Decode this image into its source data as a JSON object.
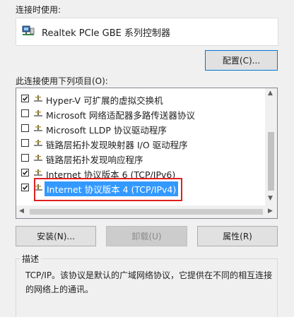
{
  "connect_using_label": "连接时使用:",
  "adapter": {
    "name": "Realtek PCIe GBE 系列控制器",
    "icon": "network-adapter-icon"
  },
  "configure_button": "配置(C)...",
  "items_label": "此连接使用下列项目(O):",
  "items": [
    {
      "label": "Hyper-V 可扩展的虚拟交换机",
      "checked": true,
      "selected": false
    },
    {
      "label": "Microsoft 网络适配器多路传送器协议",
      "checked": false,
      "selected": false
    },
    {
      "label": "Microsoft LLDP 协议驱动程序",
      "checked": false,
      "selected": false
    },
    {
      "label": "链路层拓扑发现映射器 I/O 驱动程序",
      "checked": false,
      "selected": false
    },
    {
      "label": "链路层拓扑发现响应程序",
      "checked": false,
      "selected": false
    },
    {
      "label": "Internet 协议版本 6 (TCP/IPv6)",
      "checked": true,
      "selected": false
    },
    {
      "label": "Internet 协议版本 4 (TCP/IPv4)",
      "checked": true,
      "selected": true
    }
  ],
  "install_button": "安装(N)...",
  "uninstall_button": "卸载(U)",
  "properties_button": "属性(R)",
  "description_title": "描述",
  "description_text": "TCP/IP。该协议是默认的广域网络协议，它提供在不同的相互连接的网络上的通讯。",
  "colors": {
    "selection": "#3399ff",
    "highlight_frame": "#e02020",
    "focus_border": "#0078d7"
  }
}
